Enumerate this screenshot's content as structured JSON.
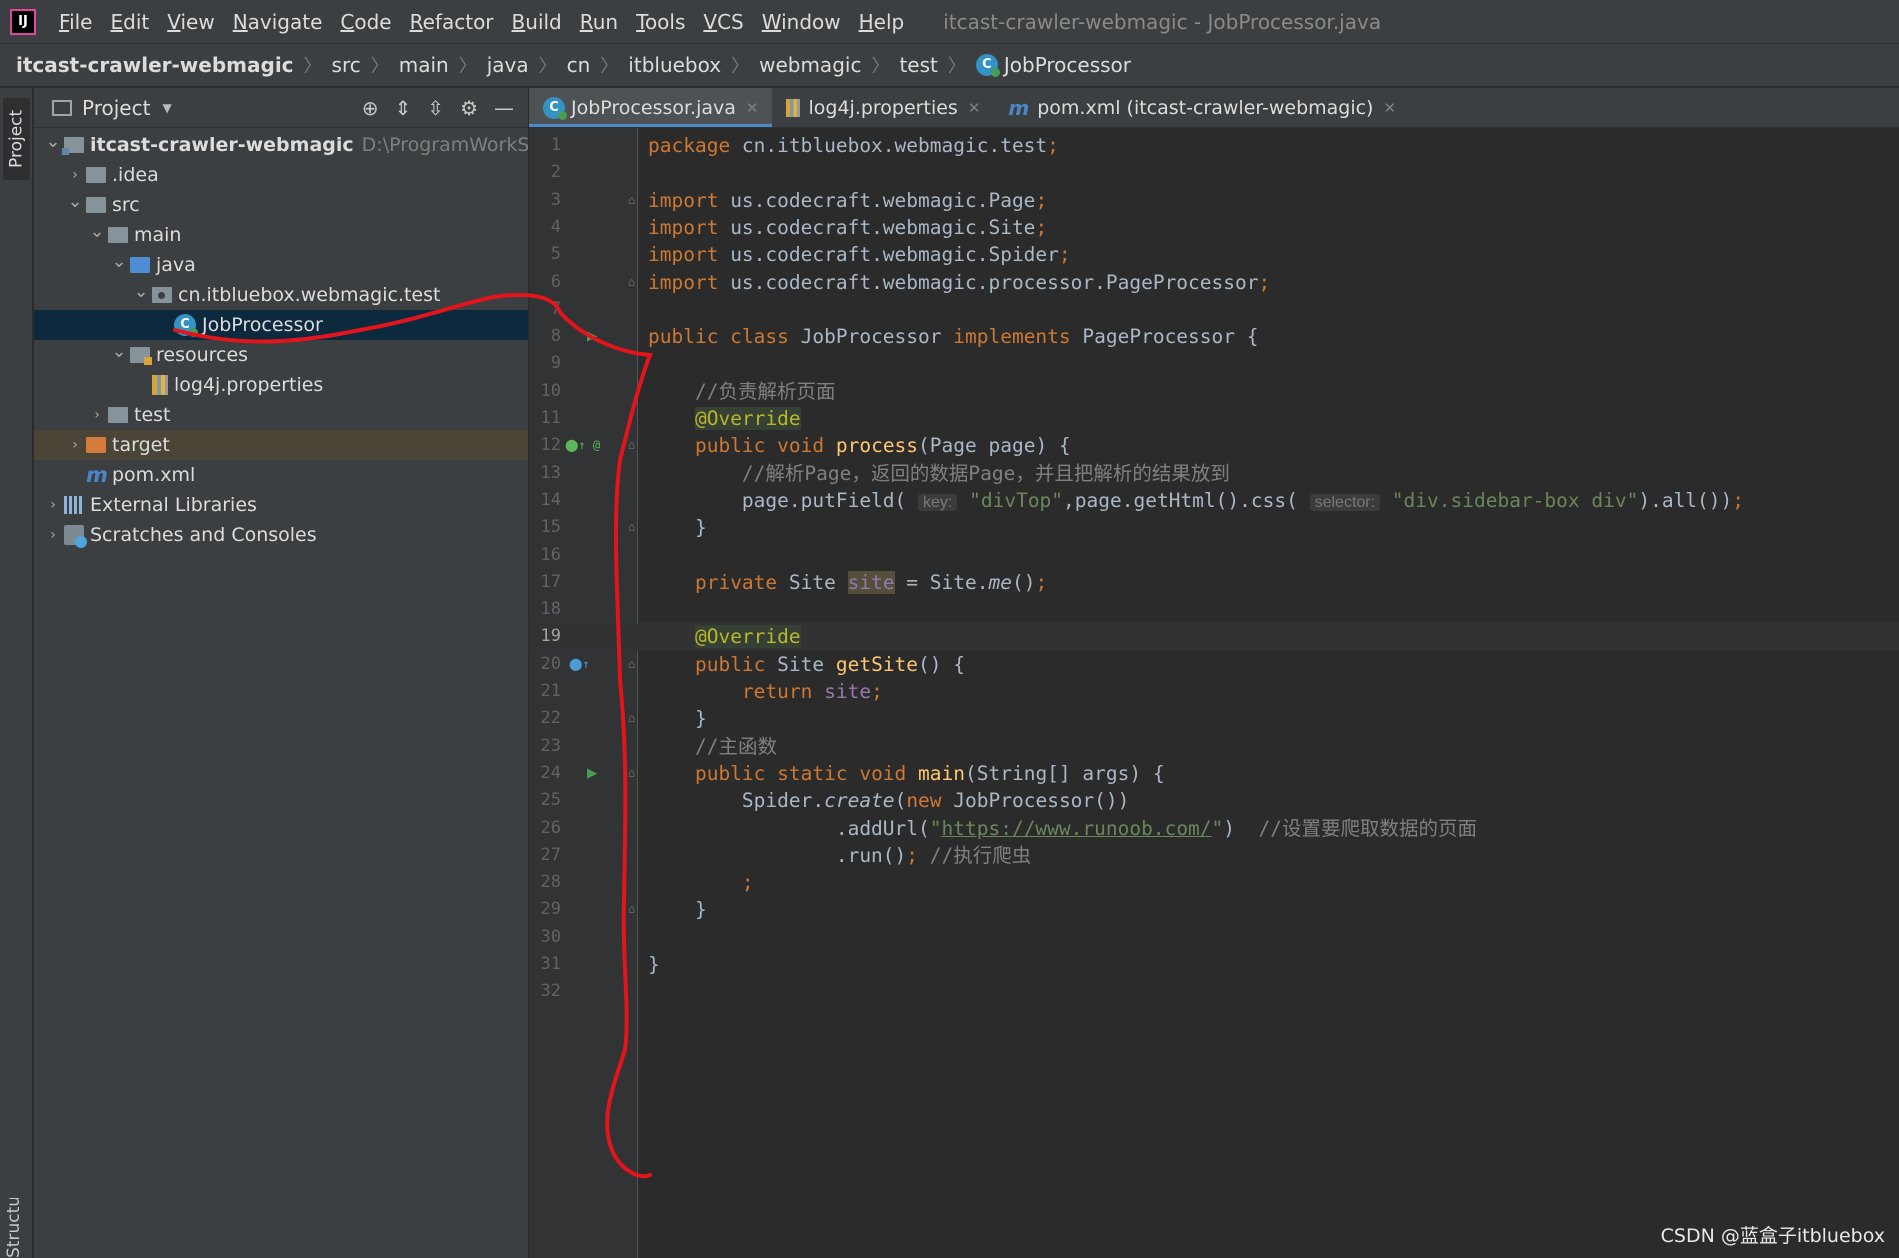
{
  "app": {
    "logo": "IJ",
    "window_title": "itcast-crawler-webmagic - JobProcessor.java"
  },
  "menu": [
    "File",
    "Edit",
    "View",
    "Navigate",
    "Code",
    "Refactor",
    "Build",
    "Run",
    "Tools",
    "VCS",
    "Window",
    "Help"
  ],
  "breadcrumb": [
    "itcast-crawler-webmagic",
    "src",
    "main",
    "java",
    "cn",
    "itbluebox",
    "webmagic",
    "test",
    "JobProcessor"
  ],
  "sidebar": {
    "stripe_top": "Project",
    "stripe_bottom": "Structure"
  },
  "project_panel": {
    "title": "Project",
    "tree": [
      {
        "label": "itcast-crawler-webmagic",
        "extra": "D:\\ProgramWorkSpace\\",
        "depth": 0,
        "arrow": "open",
        "icon": "module",
        "bold": true
      },
      {
        "label": ".idea",
        "depth": 1,
        "arrow": "closed",
        "icon": "folder"
      },
      {
        "label": "src",
        "depth": 1,
        "arrow": "open",
        "icon": "folder"
      },
      {
        "label": "main",
        "depth": 2,
        "arrow": "open",
        "icon": "folder"
      },
      {
        "label": "java",
        "depth": 3,
        "arrow": "open",
        "icon": "folder-blue"
      },
      {
        "label": "cn.itbluebox.webmagic.test",
        "depth": 4,
        "arrow": "open",
        "icon": "package"
      },
      {
        "label": "JobProcessor",
        "depth": 5,
        "arrow": "none",
        "icon": "class",
        "selected": true
      },
      {
        "label": "resources",
        "depth": 3,
        "arrow": "open",
        "icon": "folder-res"
      },
      {
        "label": "log4j.properties",
        "depth": 4,
        "arrow": "none",
        "icon": "properties"
      },
      {
        "label": "test",
        "depth": 2,
        "arrow": "closed",
        "icon": "folder"
      },
      {
        "label": "target",
        "depth": 1,
        "arrow": "closed",
        "icon": "folder-orange",
        "excluded": true
      },
      {
        "label": "pom.xml",
        "depth": 1,
        "arrow": "none",
        "icon": "maven"
      },
      {
        "label": "External Libraries",
        "depth": 0,
        "arrow": "closed",
        "icon": "library"
      },
      {
        "label": "Scratches and Consoles",
        "depth": 0,
        "arrow": "closed",
        "icon": "scratch"
      }
    ]
  },
  "tabs": [
    {
      "label": "JobProcessor.java",
      "icon": "class",
      "active": true
    },
    {
      "label": "log4j.properties",
      "icon": "properties"
    },
    {
      "label": "pom.xml (itcast-crawler-webmagic)",
      "icon": "maven"
    }
  ],
  "editor": {
    "current_line": 19,
    "lines": [
      {
        "n": 1,
        "tokens": [
          [
            "kw",
            "package "
          ],
          [
            "",
            "cn.itbluebox.webmagic.test"
          ],
          [
            "kw",
            ";"
          ]
        ]
      },
      {
        "n": 2,
        "tokens": []
      },
      {
        "n": 3,
        "fold": true,
        "tokens": [
          [
            "kw",
            "import "
          ],
          [
            "",
            "us.codecraft.webmagic.Page"
          ],
          [
            "kw",
            ";"
          ]
        ]
      },
      {
        "n": 4,
        "tokens": [
          [
            "kw",
            "import "
          ],
          [
            "",
            "us.codecraft.webmagic.Site"
          ],
          [
            "kw",
            ";"
          ]
        ]
      },
      {
        "n": 5,
        "tokens": [
          [
            "kw",
            "import "
          ],
          [
            "",
            "us.codecraft.webmagic.Spider"
          ],
          [
            "kw",
            ";"
          ]
        ]
      },
      {
        "n": 6,
        "fold": true,
        "tokens": [
          [
            "kw",
            "import "
          ],
          [
            "",
            "us.codecraft.webmagic.processor.PageProcessor"
          ],
          [
            "kw",
            ";"
          ]
        ]
      },
      {
        "n": 7,
        "tokens": []
      },
      {
        "n": 8,
        "run": true,
        "tokens": [
          [
            "kw",
            "public class "
          ],
          [
            "",
            "JobProcessor "
          ],
          [
            "kw",
            "implements "
          ],
          [
            "",
            "PageProcessor {"
          ]
        ]
      },
      {
        "n": 9,
        "tokens": []
      },
      {
        "n": 10,
        "tokens": [
          [
            "",
            "    "
          ],
          [
            "cm",
            "//负责解析页面"
          ]
        ]
      },
      {
        "n": 11,
        "tokens": [
          [
            "",
            "    "
          ],
          [
            "ann",
            "@Override"
          ]
        ]
      },
      {
        "n": 12,
        "mark": "override",
        "fold": true,
        "tokens": [
          [
            "",
            "    "
          ],
          [
            "kw",
            "public void "
          ],
          [
            "fn",
            "process"
          ],
          [
            "",
            "(Page page) {"
          ]
        ]
      },
      {
        "n": 13,
        "tokens": [
          [
            "",
            "        "
          ],
          [
            "cm",
            "//解析Page，返回的数据Page，并且把解析的结果放到"
          ]
        ]
      },
      {
        "n": 14,
        "tokens": [
          [
            "",
            "        page.putField( "
          ],
          [
            "hint",
            "key:"
          ],
          [
            "",
            ""
          ],
          [
            "str",
            " \"divTop\""
          ],
          [
            "",
            ",page.getHtml().css( "
          ],
          [
            "hint",
            "selector:"
          ],
          [
            "str",
            " \"div.sidebar-box div\""
          ],
          [
            "",
            ").all())"
          ],
          [
            "kw",
            ";"
          ]
        ]
      },
      {
        "n": 15,
        "fold": true,
        "tokens": [
          [
            "",
            "    }"
          ]
        ]
      },
      {
        "n": 16,
        "tokens": []
      },
      {
        "n": 17,
        "tokens": [
          [
            "",
            "    "
          ],
          [
            "kw",
            "private "
          ],
          [
            "",
            "Site "
          ],
          [
            "hlfield",
            "site"
          ],
          [
            "",
            " = Site."
          ],
          [
            "it",
            "me"
          ],
          [
            "",
            "()"
          ],
          [
            "kw",
            ";"
          ]
        ]
      },
      {
        "n": 18,
        "tokens": []
      },
      {
        "n": 19,
        "tokens": [
          [
            "",
            "    "
          ],
          [
            "ann",
            "@Override"
          ]
        ]
      },
      {
        "n": 20,
        "mark": "implements",
        "fold": true,
        "tokens": [
          [
            "",
            "    "
          ],
          [
            "kw",
            "public "
          ],
          [
            "",
            "Site "
          ],
          [
            "fn",
            "getSite"
          ],
          [
            "",
            "() {"
          ]
        ]
      },
      {
        "n": 21,
        "tokens": [
          [
            "",
            "        "
          ],
          [
            "kw",
            "return "
          ],
          [
            "field",
            "site"
          ],
          [
            "kw",
            ";"
          ]
        ]
      },
      {
        "n": 22,
        "fold": true,
        "tokens": [
          [
            "",
            "    }"
          ]
        ]
      },
      {
        "n": 23,
        "tokens": [
          [
            "",
            "    "
          ],
          [
            "cm",
            "//主函数"
          ]
        ]
      },
      {
        "n": 24,
        "run": true,
        "fold": true,
        "tokens": [
          [
            "",
            "    "
          ],
          [
            "kw",
            "public static void "
          ],
          [
            "fn",
            "main"
          ],
          [
            "",
            "(String[] args) {"
          ]
        ]
      },
      {
        "n": 25,
        "tokens": [
          [
            "",
            "        Spider."
          ],
          [
            "it",
            "create"
          ],
          [
            "",
            "("
          ],
          [
            "kw",
            "new "
          ],
          [
            "",
            "JobProcessor())"
          ]
        ]
      },
      {
        "n": 26,
        "tokens": [
          [
            "",
            "                .addUrl("
          ],
          [
            "str",
            "\""
          ],
          [
            "url",
            "https://www.runoob.com/"
          ],
          [
            "str",
            "\""
          ],
          [
            "",
            ")  "
          ],
          [
            "cm",
            "//设置要爬取数据的页面"
          ]
        ]
      },
      {
        "n": 27,
        "tokens": [
          [
            "",
            "                .run()"
          ],
          [
            "kw",
            "; "
          ],
          [
            "cm",
            "//执行爬虫"
          ]
        ]
      },
      {
        "n": 28,
        "tokens": [
          [
            "",
            "        "
          ],
          [
            "kw",
            ";"
          ]
        ]
      },
      {
        "n": 29,
        "fold": true,
        "tokens": [
          [
            "",
            "    }"
          ]
        ]
      },
      {
        "n": 30,
        "tokens": []
      },
      {
        "n": 31,
        "tokens": [
          [
            "",
            "}"
          ]
        ]
      },
      {
        "n": 32,
        "tokens": []
      }
    ]
  },
  "watermark": "CSDN @蓝盒子itbluebox",
  "colors": {
    "annotation": "#e3141b",
    "selection": "#0d293e",
    "accent": "#4a88c7"
  }
}
